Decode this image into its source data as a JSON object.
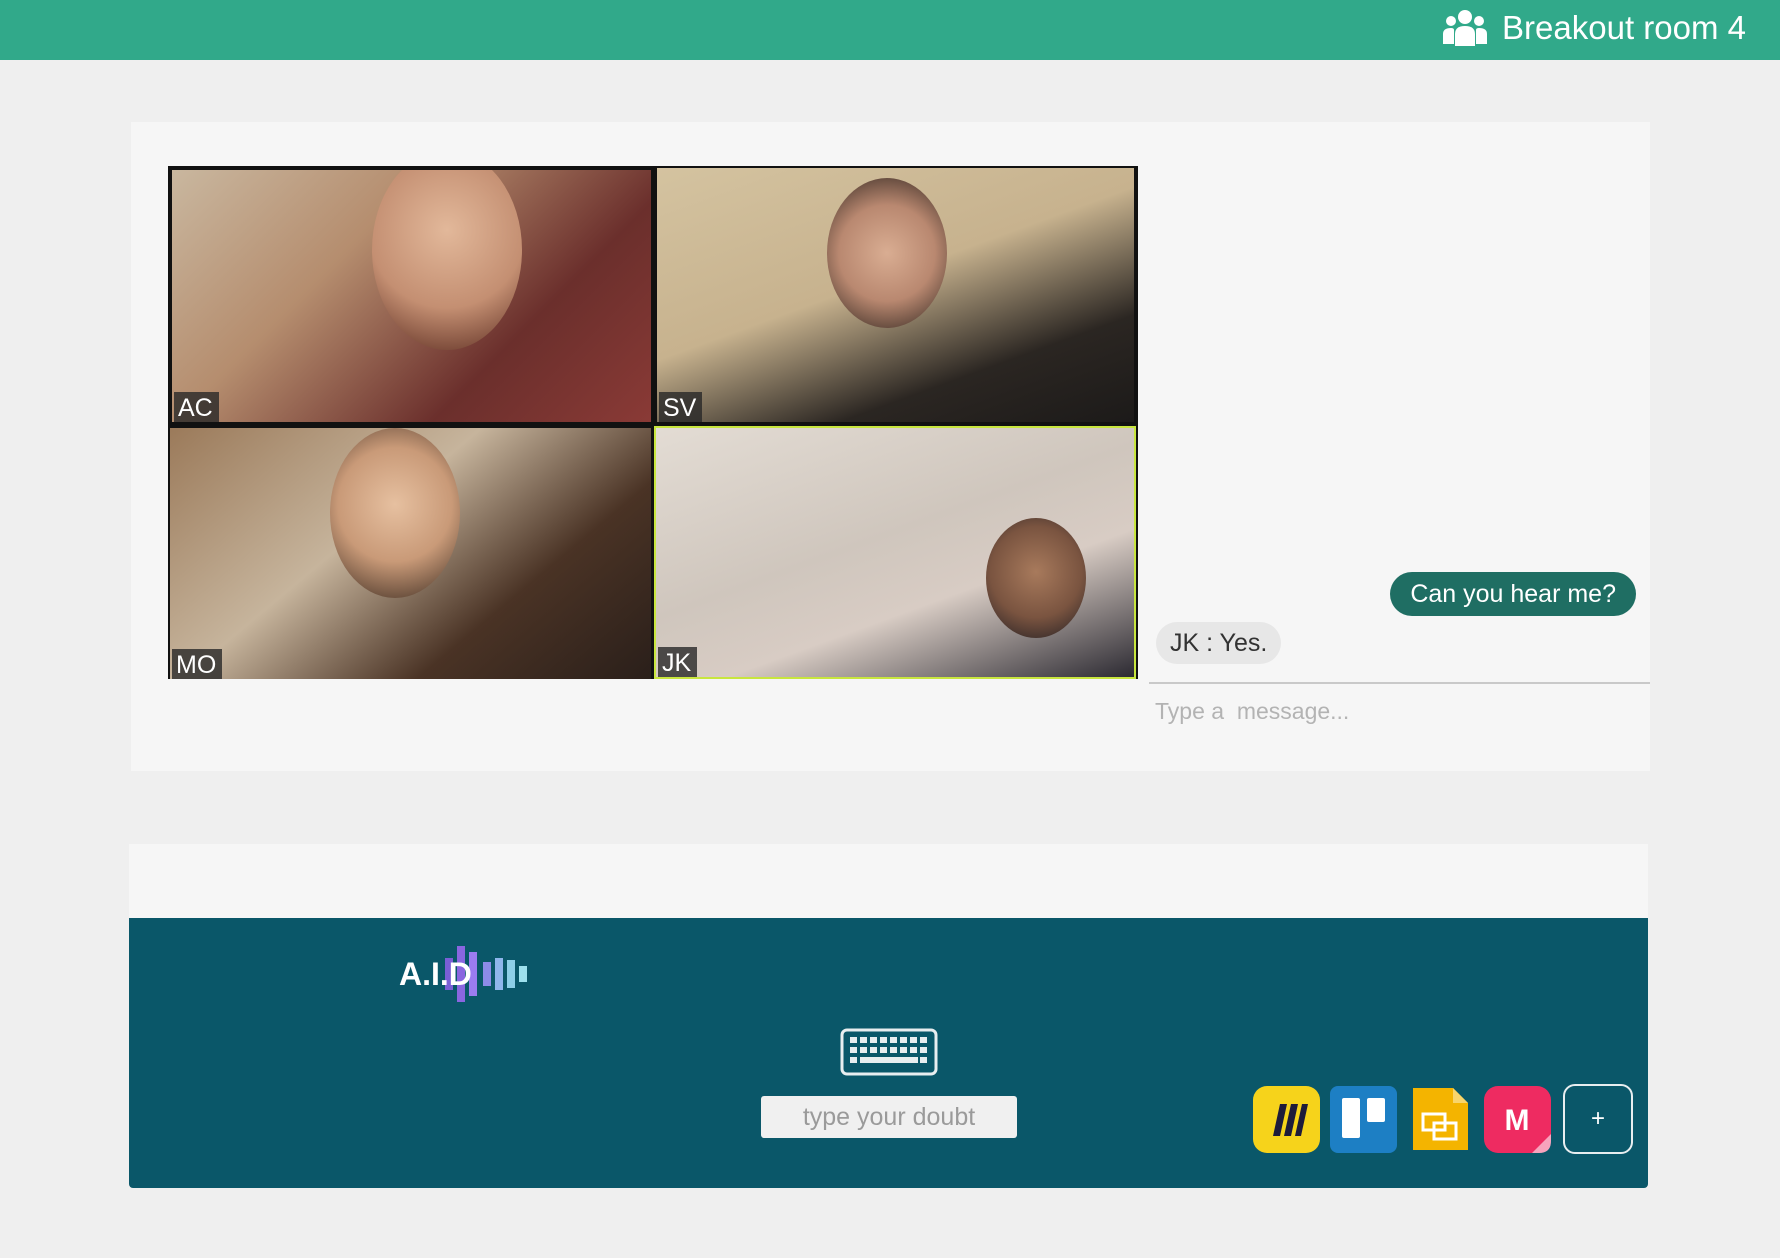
{
  "header": {
    "room_title": "Breakout room 4",
    "icon": "group-icon",
    "color": "#31a98a"
  },
  "video": {
    "tiles": [
      {
        "label": "AC"
      },
      {
        "label": "SV"
      },
      {
        "label": "MO"
      },
      {
        "label": "JK",
        "active_speaker": true
      }
    ]
  },
  "chat": {
    "messages": [
      {
        "direction": "outgoing",
        "text": "Can you hear me?"
      },
      {
        "direction": "incoming",
        "sender": "JK",
        "text": "JK :  Yes."
      }
    ],
    "input_placeholder": "Type a  message..."
  },
  "footer": {
    "logo_text": "A.I.D",
    "keyboard_icon": "keyboard-icon",
    "doubt_placeholder": "type your doubt",
    "apps": [
      "miro-icon",
      "trello-icon",
      "google-slides-icon",
      "mural-icon"
    ],
    "add_label": "+",
    "color": "#0a5769"
  }
}
